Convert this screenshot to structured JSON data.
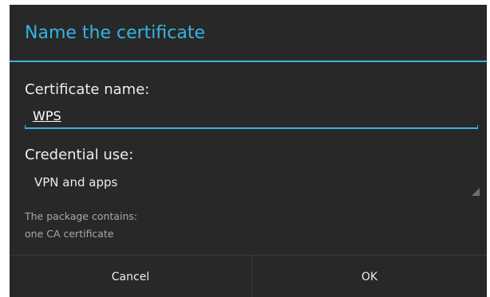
{
  "dialog": {
    "title": "Name the certificate",
    "accent_color": "#33b5e5",
    "background_color": "#282828"
  },
  "certificate_name": {
    "label": "Certificate name:",
    "value": "WPS"
  },
  "credential_use": {
    "label": "Credential use:",
    "selected": "VPN and apps",
    "icon": "spinner-triangle-icon"
  },
  "info": {
    "line1": "The package contains:",
    "line2": "one CA certificate"
  },
  "buttons": {
    "cancel_label": "Cancel",
    "ok_label": "OK"
  }
}
